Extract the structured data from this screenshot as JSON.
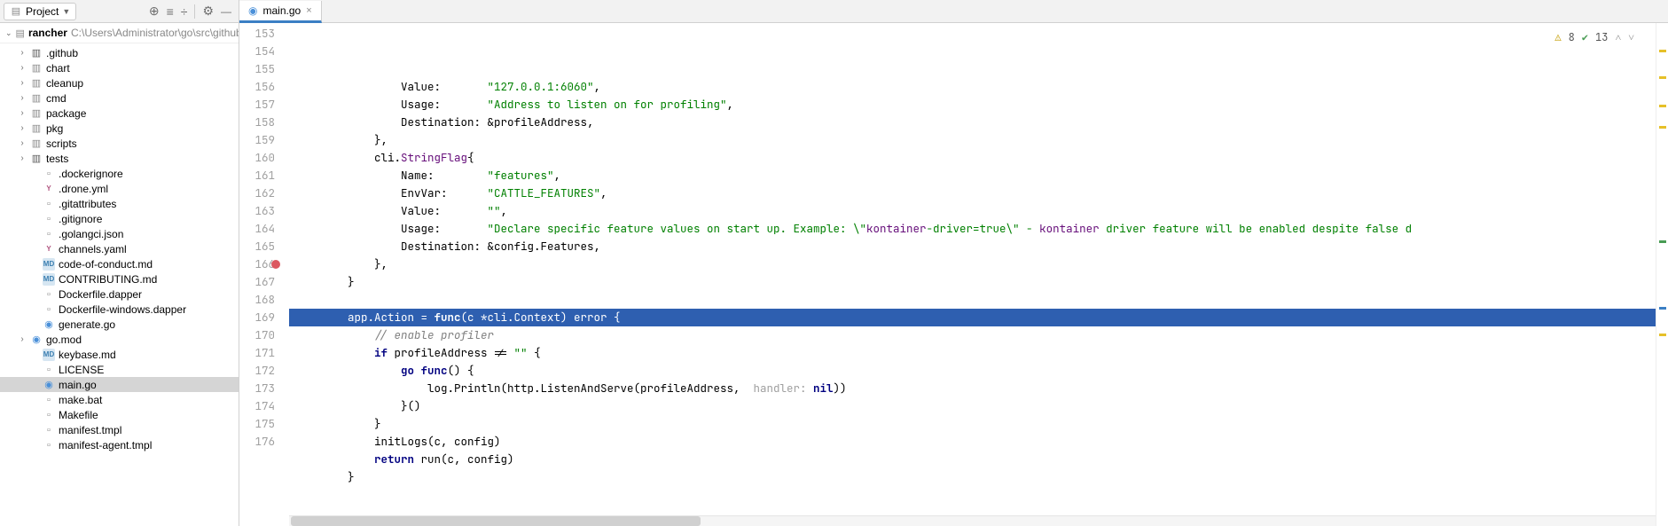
{
  "toolbar": {
    "project_label": "Project",
    "breadcrumb_root": "rancher",
    "breadcrumb_path": "C:\\Users\\Administrator\\go\\src\\github.c"
  },
  "tabs": [
    {
      "label": "main.go"
    }
  ],
  "status": {
    "warn_count": "8",
    "ok_count": "13"
  },
  "tree": [
    {
      "kind": "folder-dark",
      "label": ".github",
      "depth": 1,
      "expandable": true
    },
    {
      "kind": "folder",
      "label": "chart",
      "depth": 1,
      "expandable": true
    },
    {
      "kind": "folder",
      "label": "cleanup",
      "depth": 1,
      "expandable": true
    },
    {
      "kind": "folder",
      "label": "cmd",
      "depth": 1,
      "expandable": true
    },
    {
      "kind": "folder",
      "label": "package",
      "depth": 1,
      "expandable": true
    },
    {
      "kind": "folder",
      "label": "pkg",
      "depth": 1,
      "expandable": true
    },
    {
      "kind": "folder",
      "label": "scripts",
      "depth": 1,
      "expandable": true
    },
    {
      "kind": "folder-dark",
      "label": "tests",
      "depth": 1,
      "expandable": true
    },
    {
      "kind": "file",
      "label": ".dockerignore",
      "depth": 2
    },
    {
      "kind": "yml",
      "label": ".drone.yml",
      "depth": 2
    },
    {
      "kind": "file",
      "label": ".gitattributes",
      "depth": 2
    },
    {
      "kind": "file",
      "label": ".gitignore",
      "depth": 2
    },
    {
      "kind": "file",
      "label": ".golangci.json",
      "depth": 2
    },
    {
      "kind": "yml",
      "label": "channels.yaml",
      "depth": 2
    },
    {
      "kind": "md",
      "label": "code-of-conduct.md",
      "depth": 2
    },
    {
      "kind": "md",
      "label": "CONTRIBUTING.md",
      "depth": 2
    },
    {
      "kind": "file",
      "label": "Dockerfile.dapper",
      "depth": 2
    },
    {
      "kind": "file",
      "label": "Dockerfile-windows.dapper",
      "depth": 2
    },
    {
      "kind": "go",
      "label": "generate.go",
      "depth": 2
    },
    {
      "kind": "go",
      "label": "go.mod",
      "depth": 1,
      "expandable": true
    },
    {
      "kind": "md",
      "label": "keybase.md",
      "depth": 2
    },
    {
      "kind": "file",
      "label": "LICENSE",
      "depth": 2
    },
    {
      "kind": "go",
      "label": "main.go",
      "depth": 2,
      "selected": true
    },
    {
      "kind": "file",
      "label": "make.bat",
      "depth": 2
    },
    {
      "kind": "file",
      "label": "Makefile",
      "depth": 2
    },
    {
      "kind": "file",
      "label": "manifest.tmpl",
      "depth": 2
    },
    {
      "kind": "file",
      "label": "manifest-agent.tmpl",
      "depth": 2
    }
  ],
  "lines": {
    "start": 153,
    "breakpoint": 166,
    "rows": [
      {
        "n": 153,
        "segs": [
          [
            "p",
            "                Value:       "
          ],
          [
            "str",
            "\"127.0.0.1:6060\""
          ],
          [
            "p",
            ","
          ]
        ]
      },
      {
        "n": 154,
        "segs": [
          [
            "p",
            "                Usage:       "
          ],
          [
            "str",
            "\"Address to listen on for profiling\""
          ],
          [
            "p",
            ","
          ]
        ]
      },
      {
        "n": 155,
        "segs": [
          [
            "p",
            "                Destination: &profileAddress,"
          ]
        ]
      },
      {
        "n": 156,
        "segs": [
          [
            "p",
            "            },"
          ]
        ]
      },
      {
        "n": 157,
        "segs": [
          [
            "p",
            "            cli."
          ],
          [
            "id",
            "StringFlag"
          ],
          [
            "p",
            "{"
          ]
        ]
      },
      {
        "n": 158,
        "segs": [
          [
            "p",
            "                Name:        "
          ],
          [
            "str",
            "\"features\""
          ],
          [
            "p",
            ","
          ]
        ]
      },
      {
        "n": 159,
        "segs": [
          [
            "p",
            "                EnvVar:      "
          ],
          [
            "str",
            "\"CATTLE_FEATURES\""
          ],
          [
            "p",
            ","
          ]
        ]
      },
      {
        "n": 160,
        "segs": [
          [
            "p",
            "                Value:       "
          ],
          [
            "str",
            "\"\""
          ],
          [
            "p",
            ","
          ]
        ]
      },
      {
        "n": 161,
        "segs": [
          [
            "p",
            "                Usage:       "
          ],
          [
            "str",
            "\"Declare specific feature values on start up. Example: \\\""
          ],
          [
            "id",
            "kontainer"
          ],
          [
            "str",
            "-driver=true\\\" - "
          ],
          [
            "id",
            "kontainer"
          ],
          [
            "str",
            " driver feature will be enabled despite false d"
          ]
        ]
      },
      {
        "n": 162,
        "segs": [
          [
            "p",
            "                Destination: &config.Features,"
          ]
        ]
      },
      {
        "n": 163,
        "segs": [
          [
            "p",
            "            },"
          ]
        ]
      },
      {
        "n": 164,
        "segs": [
          [
            "p",
            "        }"
          ]
        ]
      },
      {
        "n": 165,
        "segs": [
          [
            "p",
            ""
          ]
        ]
      },
      {
        "n": 166,
        "hl": true,
        "segs": [
          [
            "p",
            "        app.Action = "
          ],
          [
            "kw",
            "func"
          ],
          [
            "p",
            "(c *cli.Context) error {"
          ]
        ]
      },
      {
        "n": 167,
        "segs": [
          [
            "p",
            "            "
          ],
          [
            "cm",
            "// enable profiler"
          ]
        ]
      },
      {
        "n": 168,
        "segs": [
          [
            "p",
            "            "
          ],
          [
            "kw",
            "if"
          ],
          [
            "p",
            " profileAddress != "
          ],
          [
            "str",
            "\"\""
          ],
          [
            "p",
            " {"
          ]
        ]
      },
      {
        "n": 169,
        "segs": [
          [
            "p",
            "                "
          ],
          [
            "kw",
            "go func"
          ],
          [
            "p",
            "() {"
          ]
        ]
      },
      {
        "n": 170,
        "segs": [
          [
            "p",
            "                    log.Println(http.ListenAndServe(profileAddress,  "
          ],
          [
            "hint",
            "handler:"
          ],
          [
            "p",
            " "
          ],
          [
            "kw",
            "nil"
          ],
          [
            "p",
            "))"
          ]
        ]
      },
      {
        "n": 171,
        "segs": [
          [
            "p",
            "                }()"
          ]
        ]
      },
      {
        "n": 172,
        "segs": [
          [
            "p",
            "            }"
          ]
        ]
      },
      {
        "n": 173,
        "segs": [
          [
            "p",
            "            initLogs(c, config)"
          ]
        ]
      },
      {
        "n": 174,
        "segs": [
          [
            "p",
            "            "
          ],
          [
            "kw",
            "return"
          ],
          [
            "p",
            " run(c, config)"
          ]
        ]
      },
      {
        "n": 175,
        "segs": [
          [
            "p",
            "        }"
          ]
        ]
      },
      {
        "n": 176,
        "segs": [
          [
            "p",
            ""
          ]
        ]
      }
    ]
  }
}
